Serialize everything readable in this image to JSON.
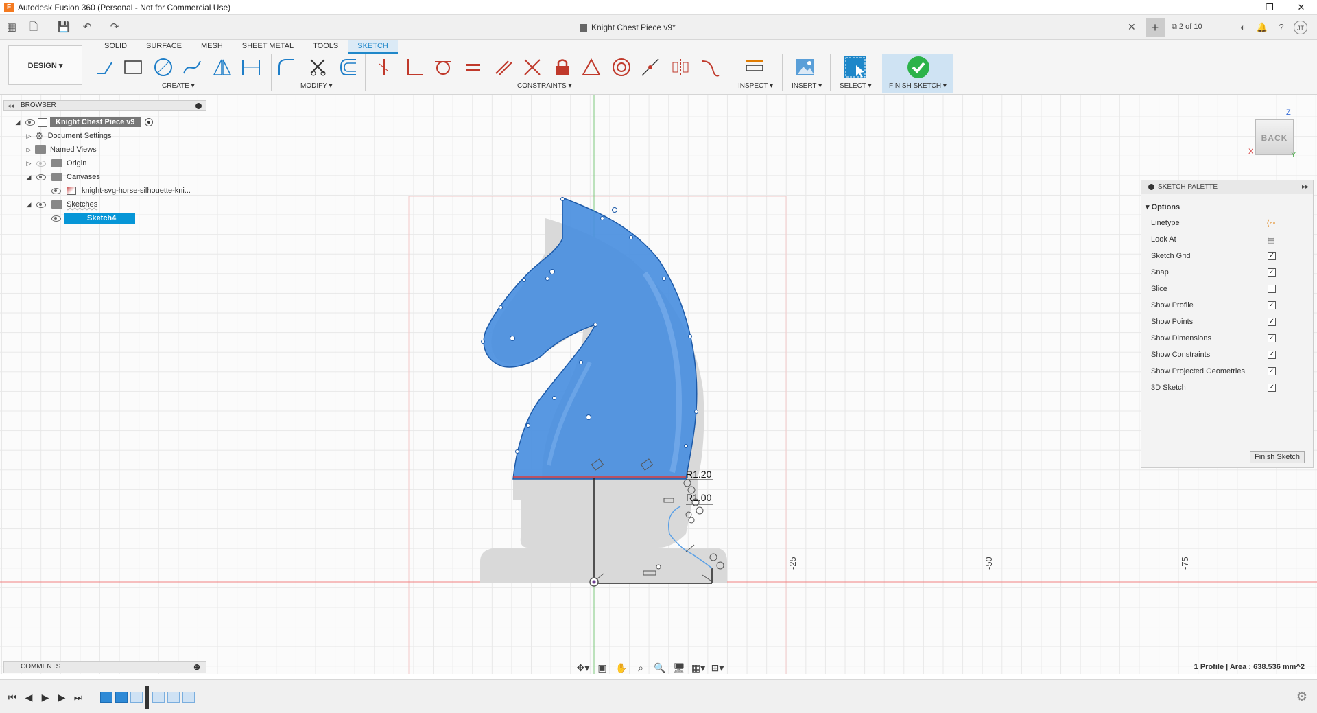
{
  "window": {
    "title": "Autodesk Fusion 360 (Personal - Not for Commercial Use)",
    "app_icon": "F",
    "controls": [
      "—",
      "❐",
      "✕"
    ]
  },
  "qat": {
    "document_title": "Knight Chest Piece v9*",
    "jobs": "2 of 10",
    "avatar": "JT"
  },
  "ribbon": {
    "tabs": [
      "SOLID",
      "SURFACE",
      "MESH",
      "SHEET METAL",
      "TOOLS",
      "SKETCH"
    ],
    "active_tab": "SKETCH",
    "workspace": "DESIGN",
    "groups": {
      "create": "CREATE",
      "modify": "MODIFY",
      "constraints": "CONSTRAINTS",
      "inspect": "INSPECT",
      "insert": "INSERT",
      "select": "SELECT",
      "finish": "FINISH SKETCH"
    },
    "accent_color": "#0696d7",
    "finish_color": "#2db34a"
  },
  "browser": {
    "title": "BROWSER",
    "root": "Knight Chest Piece v9",
    "items": [
      {
        "label": "Document Settings"
      },
      {
        "label": "Named Views"
      },
      {
        "label": "Origin"
      },
      {
        "label": "Canvases"
      },
      {
        "label": "knight-svg-horse-silhouette-kni..."
      },
      {
        "label": "Sketches"
      },
      {
        "label": "Sketch4"
      }
    ]
  },
  "canvas": {
    "dimension_1": "R1.20",
    "dimension_2": "R1.00",
    "axis_labels": [
      "-25",
      "-50",
      "-75"
    ],
    "profile_color": "#4a8fe0"
  },
  "viewcube": {
    "face": "BACK",
    "axis_z": "Z",
    "axis_x": "X",
    "axis_y": "Y"
  },
  "palette": {
    "title": "SKETCH PALETTE",
    "section": "Options",
    "options": [
      {
        "label": "Linetype",
        "kind": "linetype-icons"
      },
      {
        "label": "Look At",
        "kind": "look-at-icon"
      },
      {
        "label": "Sketch Grid",
        "checked": "✓"
      },
      {
        "label": "Snap",
        "checked": "✓"
      },
      {
        "label": "Slice",
        "checked": ""
      },
      {
        "label": "Show Profile",
        "checked": "✓"
      },
      {
        "label": "Show Points",
        "checked": "✓"
      },
      {
        "label": "Show Dimensions",
        "checked": "✓"
      },
      {
        "label": "Show Constraints",
        "checked": "✓"
      },
      {
        "label": "Show Projected Geometries",
        "checked": "✓"
      },
      {
        "label": "3D Sketch",
        "checked": "✓"
      }
    ],
    "finish_button": "Finish Sketch"
  },
  "comments": {
    "title": "COMMENTS"
  },
  "status": {
    "text": "1 Profile | Area : 638.536 mm^2"
  }
}
